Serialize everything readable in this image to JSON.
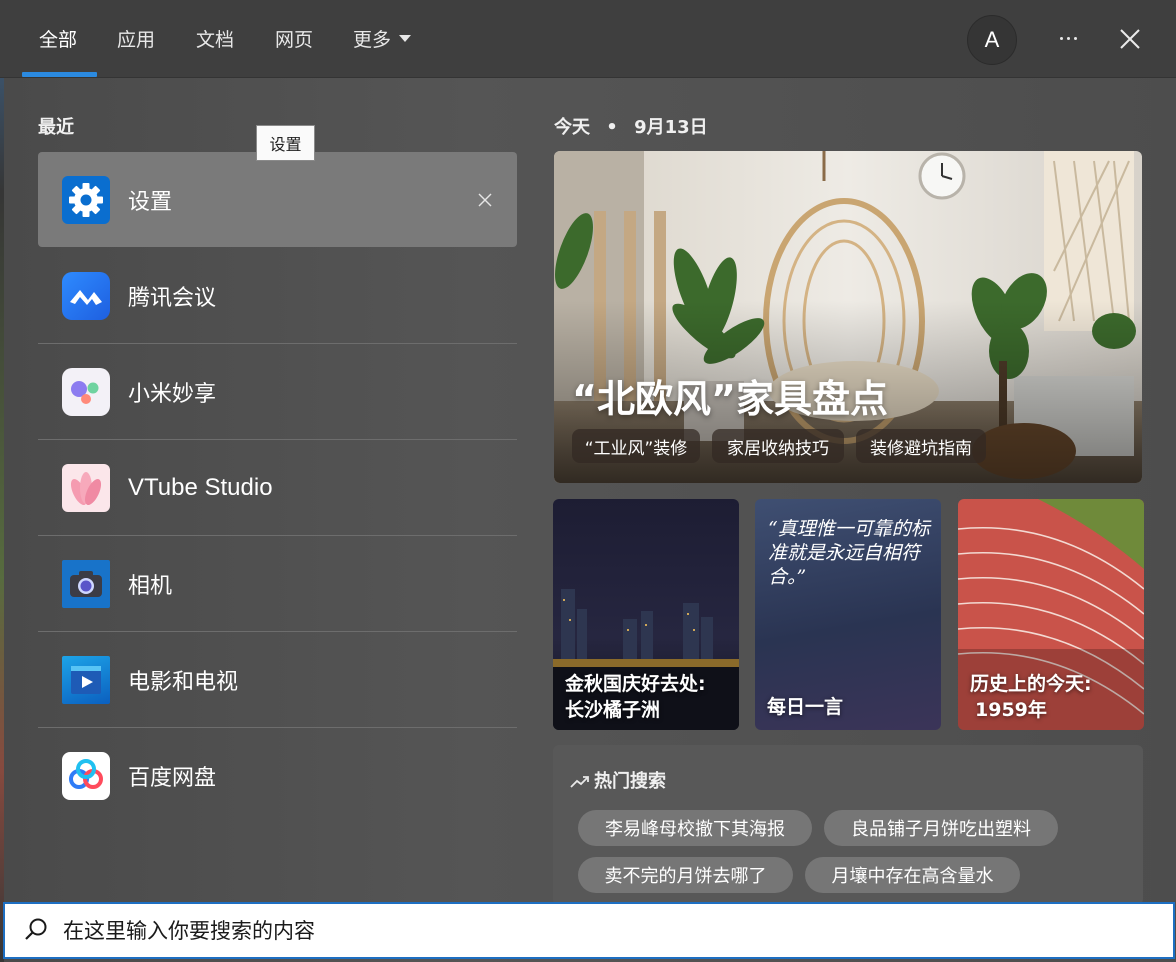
{
  "header": {
    "tabs": [
      {
        "label": "全部",
        "active": true
      },
      {
        "label": "应用",
        "active": false
      },
      {
        "label": "文档",
        "active": false
      },
      {
        "label": "网页",
        "active": false
      },
      {
        "label": "更多",
        "active": false
      }
    ],
    "avatar_letter": "A",
    "accent_color": "#2b8ae0"
  },
  "recent": {
    "heading": "最近",
    "tooltip": "设置",
    "items": [
      {
        "label": "设置",
        "icon": "gear-icon",
        "selected": true
      },
      {
        "label": "腾讯会议",
        "icon": "tencent-meeting-icon"
      },
      {
        "label": "小米妙享",
        "icon": "xiaomi-miaoxiang-icon"
      },
      {
        "label": "VTube Studio",
        "icon": "vtube-studio-icon"
      },
      {
        "label": "相机",
        "icon": "camera-icon"
      },
      {
        "label": "电影和电视",
        "icon": "movies-tv-icon"
      },
      {
        "label": "百度网盘",
        "icon": "baidu-netdisk-icon"
      }
    ]
  },
  "today": {
    "label": "今天",
    "separator": "•",
    "date": "9月13日",
    "hero": {
      "title": "“北欧风”家具盘点",
      "chips": [
        "“工业风”装修",
        "家居收纳技巧",
        "装修避坑指南"
      ]
    },
    "cards": [
      {
        "line1": "金秋国庆好去处:",
        "line2": "长沙橘子洲"
      },
      {
        "quote": "“真理惟一可靠的标准就是永远自相符合。”",
        "title": "每日一言"
      },
      {
        "line1": "历史上的今天:",
        "line2": "1959年"
      }
    ]
  },
  "trending": {
    "heading": "热门搜索",
    "items": [
      "李易峰母校撤下其海报",
      "良品铺子月饼吃出塑料",
      "卖不完的月饼去哪了",
      "月壤中存在高含量水"
    ]
  },
  "search": {
    "placeholder": "在这里输入你要搜索的内容",
    "value": ""
  }
}
